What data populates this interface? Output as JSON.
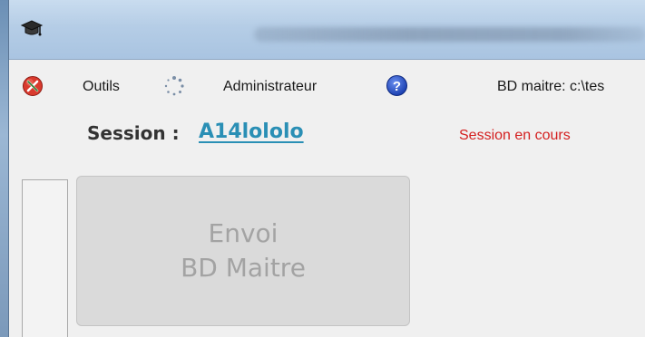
{
  "window": {
    "app_icon": "graduation-cap-icon"
  },
  "menubar": {
    "items": [
      {
        "icon": "red-tools-icon",
        "label": ""
      },
      {
        "icon": "",
        "label": "Outils"
      },
      {
        "icon": "refresh-icon",
        "label": ""
      },
      {
        "icon": "",
        "label": "Administrateur"
      },
      {
        "icon": "help-icon",
        "label": ""
      }
    ],
    "db_master_text": "BD maitre: c:\\tes"
  },
  "session": {
    "label": "Session :",
    "value": "A14lololo",
    "status": "Session en cours"
  },
  "main": {
    "send_button": {
      "line1": "Envoi",
      "line2": "BD Maitre"
    }
  },
  "colors": {
    "session_link": "#2a8fb5",
    "status_text": "#d42020",
    "button_bg": "#dadada",
    "button_text": "#a3a3a3",
    "titlebar": "#b5cde6"
  }
}
